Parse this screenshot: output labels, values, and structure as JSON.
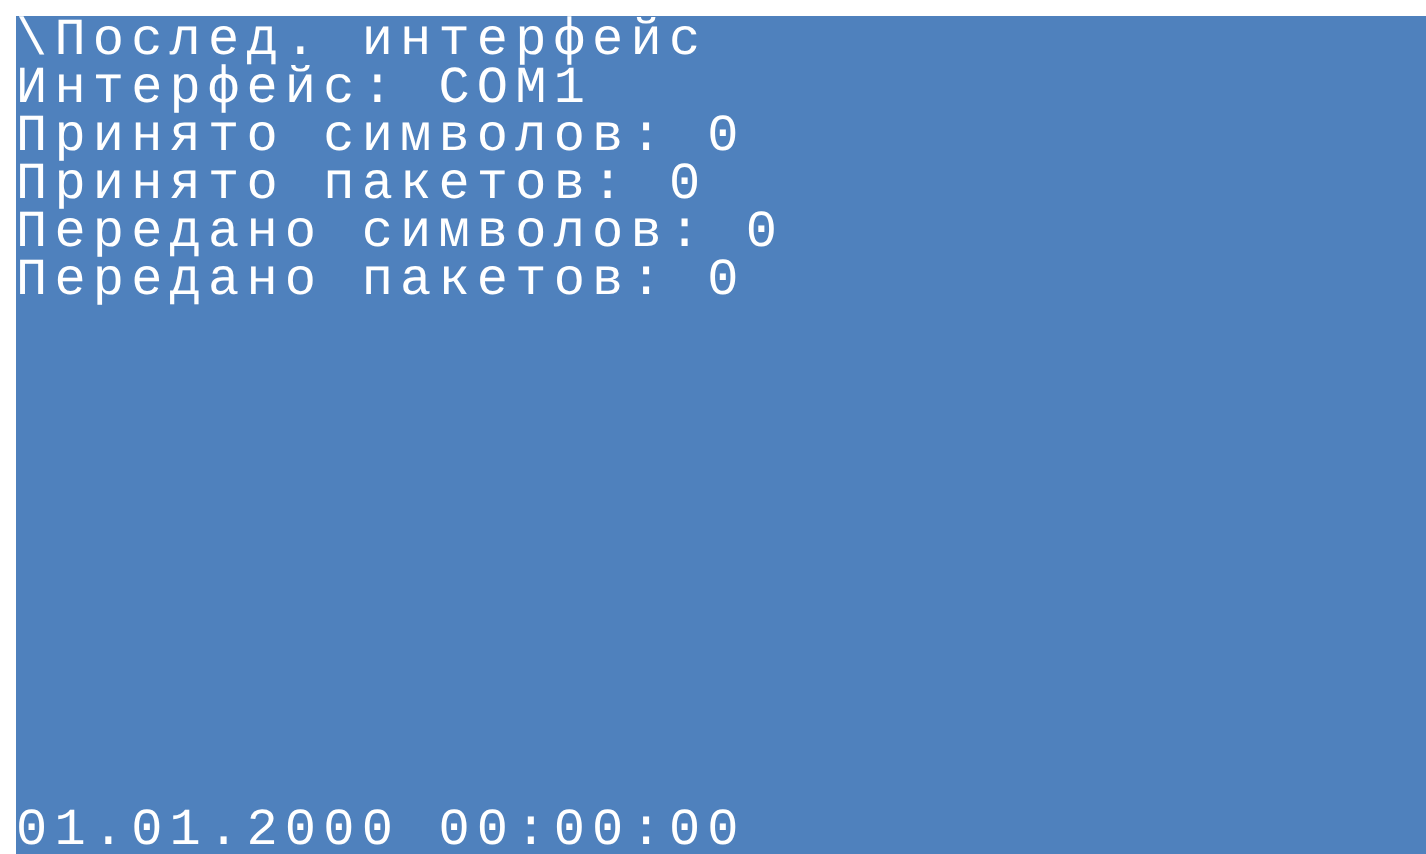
{
  "screen": {
    "title": "\\Послед. интерфейс",
    "lines": [
      "Интерфейс: COM1",
      "Принято символов: 0",
      "Принято пакетов: 0",
      "Передано символов: 0",
      "Передано пакетов: 0"
    ],
    "datetime": "01.01.2000 00:00:00"
  }
}
